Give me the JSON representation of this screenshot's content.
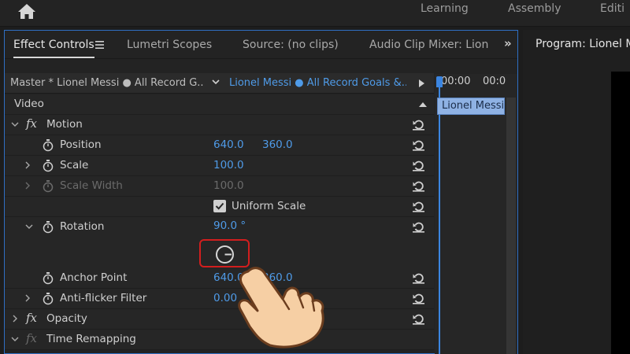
{
  "workspaces": [
    "Learning",
    "Assembly",
    "Editi"
  ],
  "tabs": {
    "effect_controls": "Effect Controls",
    "lumetri": "Lumetri Scopes",
    "source": "Source: (no clips)",
    "audio_mixer": "Audio Clip Mixer: Lion",
    "more": "»"
  },
  "clipbar": {
    "master": "Master * Lionel Messi ● All Record G...",
    "sequence": "Lionel Messi ● All Record Goals &..."
  },
  "timeline": {
    "time_start": "00:00",
    "time_next": "00:0",
    "clip_label": "Lionel Messi"
  },
  "program": {
    "tab_label": "Program: Lionel M"
  },
  "rows": {
    "video": "Video",
    "motion": "Motion",
    "position": {
      "label": "Position",
      "x": "640.0",
      "y": "360.0"
    },
    "scale": {
      "label": "Scale",
      "value": "100.0"
    },
    "scale_width": {
      "label": "Scale Width",
      "value": "100.0"
    },
    "uniform_scale": {
      "label": "Uniform Scale",
      "checked": true
    },
    "rotation": {
      "label": "Rotation",
      "value": "90.0 °"
    },
    "anchor_point": {
      "label": "Anchor Point",
      "x": "640.0",
      "y": "360.0"
    },
    "anti_flicker": {
      "label": "Anti-flicker Filter",
      "value": "0.00"
    },
    "opacity": "Opacity",
    "time_remapping": "Time Remapping"
  },
  "fx_label": "fx",
  "colors": {
    "accent": "#4f9be8",
    "highlight": "#d21e1e",
    "panel_border": "#2f6fc4"
  }
}
